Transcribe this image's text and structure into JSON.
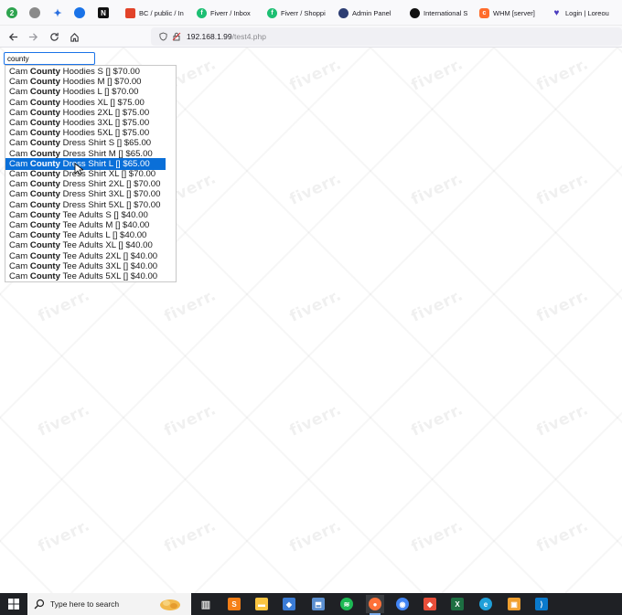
{
  "bookmarks": [
    {
      "icon": "green-circle-icon",
      "label": ""
    },
    {
      "icon": "grey-circle-icon",
      "label": ""
    },
    {
      "icon": "blue-sparkle-icon",
      "label": ""
    },
    {
      "icon": "chat-bubble-icon",
      "label": ""
    },
    {
      "icon": "notion-icon",
      "label": ""
    },
    {
      "icon": "gitlab-icon",
      "label": "BC / public / In"
    },
    {
      "icon": "fiverr-icon",
      "label": "Fiverr / Inbox"
    },
    {
      "icon": "fiverr-icon",
      "label": "Fiverr / Shoppi"
    },
    {
      "icon": "globe-icon",
      "label": "Admin Panel"
    },
    {
      "icon": "circle-dark-icon",
      "label": "International S"
    },
    {
      "icon": "cpanel-icon",
      "label": "WHM [server]"
    },
    {
      "icon": "heart-icon",
      "label": "Login | Loreou"
    }
  ],
  "toolbar": {
    "back": "back-arrow-icon",
    "forward": "forward-arrow-icon",
    "reload": "reload-icon",
    "home": "home-icon",
    "url_host": "192.168.1.99",
    "url_path": "/test4.php"
  },
  "search": {
    "value": "county"
  },
  "watermark_text": "fiverr.",
  "dropdown": {
    "selected_index": 9,
    "items": [
      {
        "pre": "Cam ",
        "match": "County",
        "post": " Hoodies S [] $70.00"
      },
      {
        "pre": "Cam ",
        "match": "County",
        "post": " Hoodies M [] $70.00"
      },
      {
        "pre": "Cam ",
        "match": "County",
        "post": " Hoodies L [] $70.00"
      },
      {
        "pre": "Cam ",
        "match": "County",
        "post": " Hoodies XL [] $75.00"
      },
      {
        "pre": "Cam ",
        "match": "County",
        "post": " Hoodies 2XL [] $75.00"
      },
      {
        "pre": "Cam ",
        "match": "County",
        "post": " Hoodies 3XL [] $75.00"
      },
      {
        "pre": "Cam ",
        "match": "County",
        "post": " Hoodies 5XL [] $75.00"
      },
      {
        "pre": "Cam ",
        "match": "County",
        "post": " Dress Shirt S [] $65.00"
      },
      {
        "pre": "Cam ",
        "match": "County",
        "post": " Dress Shirt M [] $65.00"
      },
      {
        "pre": "Cam ",
        "match": "County",
        "post": " Dress Shirt L [] $65.00"
      },
      {
        "pre": "Cam ",
        "match": "County",
        "post": " Dress Shirt XL [] $70.00"
      },
      {
        "pre": "Cam ",
        "match": "County",
        "post": " Dress Shirt 2XL [] $70.00"
      },
      {
        "pre": "Cam ",
        "match": "County",
        "post": " Dress Shirt 3XL [] $70.00"
      },
      {
        "pre": "Cam ",
        "match": "County",
        "post": " Dress Shirt 5XL [] $70.00"
      },
      {
        "pre": "Cam ",
        "match": "County",
        "post": " Tee Adults S [] $40.00"
      },
      {
        "pre": "Cam ",
        "match": "County",
        "post": " Tee Adults M [] $40.00"
      },
      {
        "pre": "Cam ",
        "match": "County",
        "post": " Tee Adults L [] $40.00"
      },
      {
        "pre": "Cam ",
        "match": "County",
        "post": " Tee Adults XL [] $40.00"
      },
      {
        "pre": "Cam ",
        "match": "County",
        "post": " Tee Adults 2XL [] $40.00"
      },
      {
        "pre": "Cam ",
        "match": "County",
        "post": " Tee Adults 3XL [] $40.00"
      },
      {
        "pre": "Cam ",
        "match": "County",
        "post": " Tee Adults 5XL [] $40.00"
      }
    ]
  },
  "taskbar": {
    "search_placeholder": "Type here to search",
    "apps": [
      {
        "icon": "task-view-icon",
        "color": "#1f2125"
      },
      {
        "icon": "sublime-text-icon",
        "color": "#f57f17"
      },
      {
        "icon": "file-explorer-icon",
        "color": "#f9c440"
      },
      {
        "icon": "network-app-icon",
        "color": "#3a7bd5"
      },
      {
        "icon": "network-share-icon",
        "color": "#5b8fd0"
      },
      {
        "icon": "spotify-icon",
        "color": "#1db954"
      },
      {
        "icon": "firefox-icon",
        "color": "#ff7139"
      },
      {
        "icon": "chrome-icon",
        "color": "#4285f4"
      },
      {
        "icon": "git-icon",
        "color": "#e84e3a"
      },
      {
        "icon": "excel-icon",
        "color": "#1d6f42"
      },
      {
        "icon": "edge-icon",
        "color": "#1fa0d9"
      },
      {
        "icon": "app-square-icon",
        "color": "#f0a030"
      },
      {
        "icon": "vscode-icon",
        "color": "#0a7acc"
      }
    ]
  }
}
